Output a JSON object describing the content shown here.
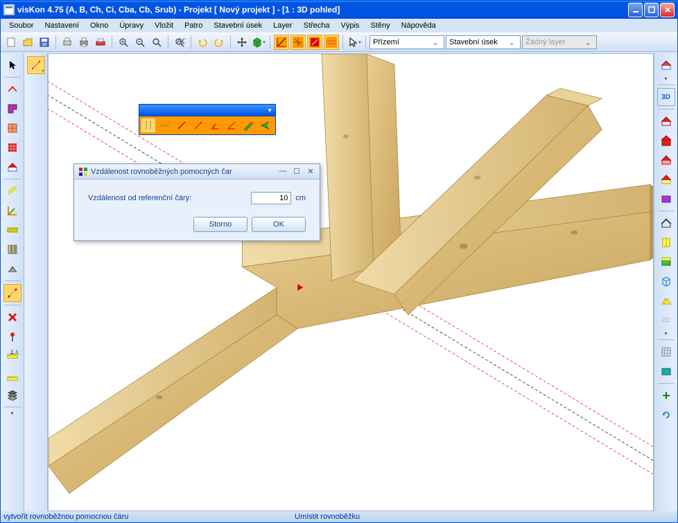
{
  "title": "visKon 4.75 (A, B, Ch, Ci, Cba, Cb, Srub) - Projekt [ Nový projekt ]  - [1 : 3D pohled]",
  "menu": {
    "file": "Soubor",
    "settings": "Nastavení",
    "window": "Okno",
    "edit": "Úpravy",
    "insert": "Vložit",
    "floor": "Patro",
    "section": "Stavební úsek",
    "layer": "Layer",
    "roof": "Střecha",
    "list": "Výpis",
    "walls": "Stěny",
    "help": "Nápověda"
  },
  "combos": {
    "floor": "Přízemí",
    "section": "Stavební úsek",
    "layer": "Žádný layer"
  },
  "dialog": {
    "title": "Vzdálenost rovnoběžných pomocných čar",
    "label": "Vzdálenost od referenční čáry:",
    "value": "10",
    "unit": "cm",
    "cancel": "Storno",
    "ok": "OK"
  },
  "status": {
    "left": "vytvořit rovnoběžnou pomocnou čáru",
    "right": "Umístit rovnoběžku"
  }
}
